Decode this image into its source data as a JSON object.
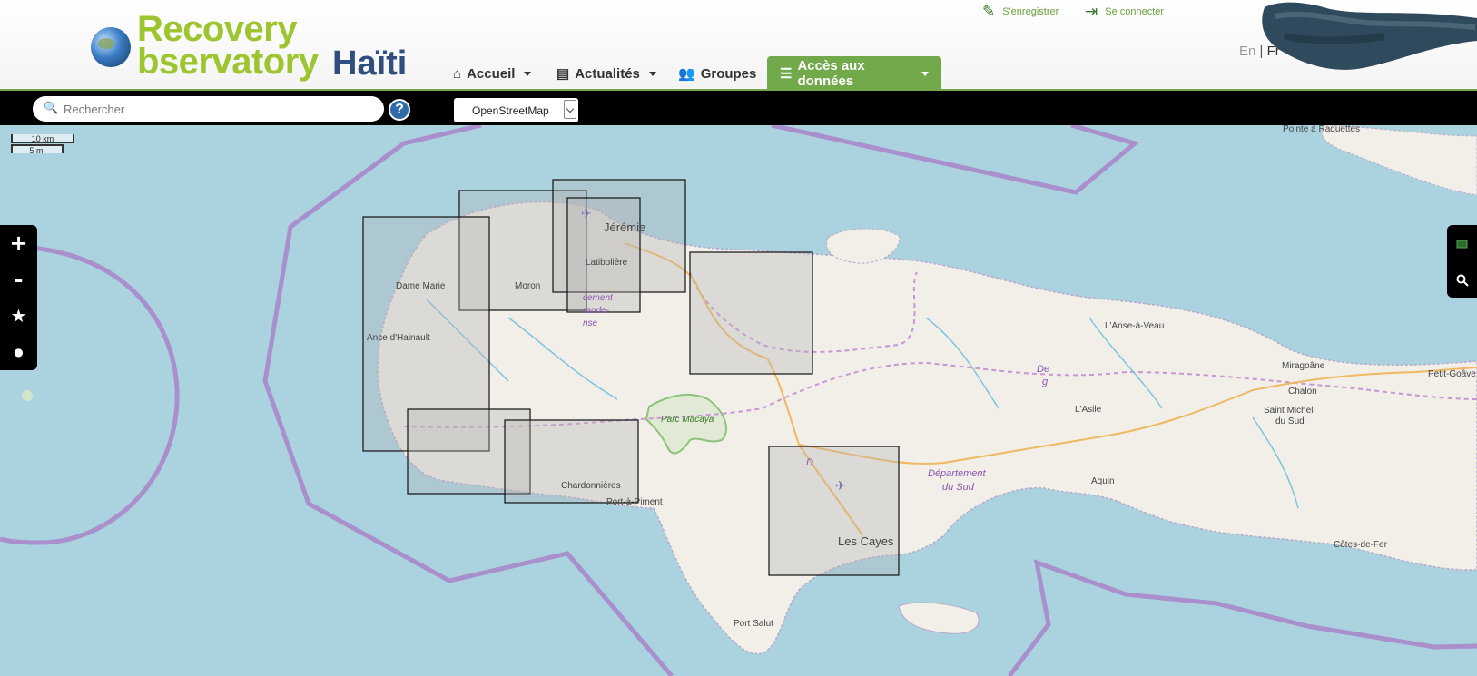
{
  "header": {
    "logo_line1": "Recovery",
    "logo_line2": "bservatory",
    "logo_country": "Haïti",
    "register": "S'enregistrer",
    "login": "Se connecter",
    "lang_en": "En",
    "lang_sep": "|",
    "lang_fr": "Fr"
  },
  "nav": {
    "home": "Accueil",
    "news": "Actualités",
    "groups": "Groupes",
    "data": "Accès aux données"
  },
  "toolbar": {
    "search_placeholder": "Rechercher",
    "help": "?",
    "layer": "OpenStreetMap"
  },
  "map": {
    "scale_km": "10 km",
    "scale_mi": "5 mi",
    "zoom_in": "+",
    "zoom_out": "-",
    "favorite": "★",
    "point": "●",
    "labels": {
      "jeremie": "Jérémie",
      "latiboliere": "Latibolière",
      "dame_marie": "Dame Marie",
      "moron": "Moron",
      "anse_hainault": "Anse d'Hainault",
      "dept_1": "cement",
      "dept_2": "rande-",
      "dept_3": "nse",
      "parc": "Parc Macaya",
      "chardonnieres": "Chardonnières",
      "port_piment": "Port-à-Piment",
      "les_cayes": "Les Cayes",
      "port_salut": "Port Salut",
      "dept_sud_1": "Département",
      "dept_sud_2": "du Sud",
      "d_partial": "D",
      "de_partial": "De",
      "g_partial": "g",
      "anse_veau": "L'Anse-à-Veau",
      "asile": "L'Asile",
      "miragoane": "Miragoâne",
      "chalon": "Chalon",
      "saint_michel_1": "Saint Michel",
      "saint_michel_2": "du Sud",
      "aquin": "Aquin",
      "cotes_fer": "Côtes-de-Fer",
      "petit_goave": "Petit-Goâve",
      "pointe_raquettes": "Pointe à Raquettes"
    }
  },
  "colors": {
    "brand_green": "#72a94a",
    "logo_green": "#9dc530",
    "logo_blue": "#2f4d7e",
    "sea": "#aad3df",
    "land": "#f2efe9",
    "boundary": "#a98fcc",
    "footprint_fill": "#b4b4b4"
  }
}
